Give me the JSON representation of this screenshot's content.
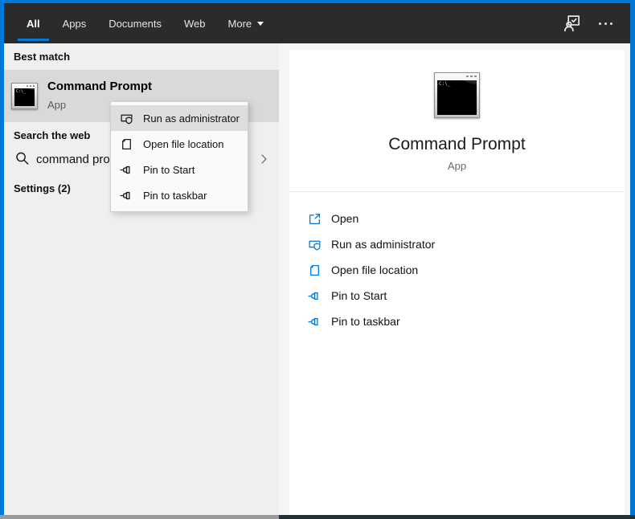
{
  "colors": {
    "accent": "#0078d7",
    "action_icon_blue": "#0078d7",
    "header_bg": "#2b2b2b"
  },
  "header": {
    "active_tab": "All",
    "tabs": [
      {
        "label": "All"
      },
      {
        "label": "Apps"
      },
      {
        "label": "Documents"
      },
      {
        "label": "Web"
      },
      {
        "label": "More"
      }
    ]
  },
  "left_panel": {
    "best_match_heading": "Best match",
    "best_match": {
      "title": "Command Prompt",
      "type": "App"
    },
    "search_web_heading": "Search the web",
    "search_query": "command pro",
    "settings_heading": "Settings (2)"
  },
  "context_menu": {
    "items": [
      {
        "label": "Run as administrator"
      },
      {
        "label": "Open file location"
      },
      {
        "label": "Pin to Start"
      },
      {
        "label": "Pin to taskbar"
      }
    ]
  },
  "preview_panel": {
    "title": "Command Prompt",
    "type": "App",
    "actions": [
      {
        "label": "Open"
      },
      {
        "label": "Run as administrator"
      },
      {
        "label": "Open file location"
      },
      {
        "label": "Pin to Start"
      },
      {
        "label": "Pin to taskbar"
      }
    ]
  }
}
